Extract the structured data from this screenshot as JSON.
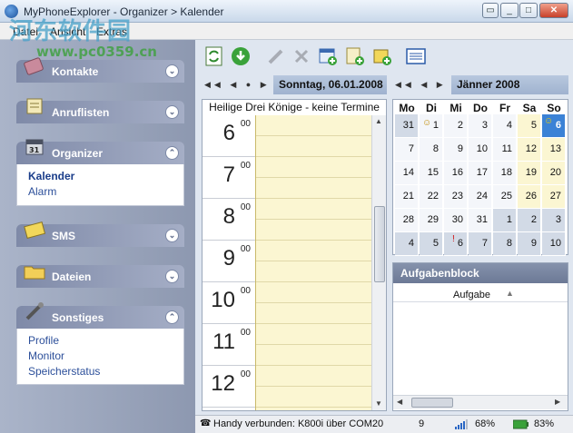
{
  "window": {
    "title": "MyPhoneExplorer - Organizer > Kalender"
  },
  "watermark": {
    "text": "河东软件园",
    "url": "www.pc0359.cn"
  },
  "menu": [
    "Datei",
    "Ansicht",
    "Extras"
  ],
  "sidebar": {
    "groups": [
      {
        "label": "Kontakte",
        "icon": "contacts-book-icon",
        "items": []
      },
      {
        "label": "Anruflisten",
        "icon": "call-lists-icon",
        "items": []
      },
      {
        "label": "Organizer",
        "icon": "calendar-organizer-icon",
        "items": [
          "Kalender",
          "Alarm"
        ],
        "active": "Kalender"
      },
      {
        "label": "SMS",
        "icon": "sms-envelope-icon",
        "items": []
      },
      {
        "label": "Dateien",
        "icon": "folder-icon",
        "items": []
      },
      {
        "label": "Sonstiges",
        "icon": "tools-icon",
        "items": [
          "Profile",
          "Monitor",
          "Speicherstatus"
        ]
      }
    ]
  },
  "day_view": {
    "date_label": "Sonntag, 06.01.2008",
    "title": "Heilige Drei Könige - keine Termine",
    "hours": [
      {
        "h": "6",
        "m": "00"
      },
      {
        "h": "7",
        "m": "00"
      },
      {
        "h": "8",
        "m": "00"
      },
      {
        "h": "9",
        "m": "00"
      },
      {
        "h": "10",
        "m": "00"
      },
      {
        "h": "11",
        "m": "00"
      },
      {
        "h": "12",
        "m": "00"
      }
    ]
  },
  "month_view": {
    "month_label": "Jänner 2008",
    "weekdays": [
      "Mo",
      "Di",
      "Mi",
      "Do",
      "Fr",
      "Sa",
      "So"
    ],
    "weeks": [
      [
        "31",
        "1",
        "2",
        "3",
        "4",
        "5",
        "6"
      ],
      [
        "7",
        "8",
        "9",
        "10",
        "11",
        "12",
        "13"
      ],
      [
        "14",
        "15",
        "16",
        "17",
        "18",
        "19",
        "20"
      ],
      [
        "21",
        "22",
        "23",
        "24",
        "25",
        "26",
        "27"
      ],
      [
        "28",
        "29",
        "30",
        "31",
        "1",
        "2",
        "3"
      ],
      [
        "4",
        "5",
        "6",
        "7",
        "8",
        "9",
        "10"
      ]
    ]
  },
  "tasks": {
    "title": "Aufgabenblock",
    "column": "Aufgabe"
  },
  "status": {
    "connection": "Handy verbunden: K800i über COM20",
    "count": "9",
    "signal": "68%",
    "battery": "83%"
  },
  "colors": {
    "accent": "#3b82d6",
    "sidebar": "#8d98b0",
    "header_bar": "#9fb2cf",
    "today": "#3b82d6"
  }
}
